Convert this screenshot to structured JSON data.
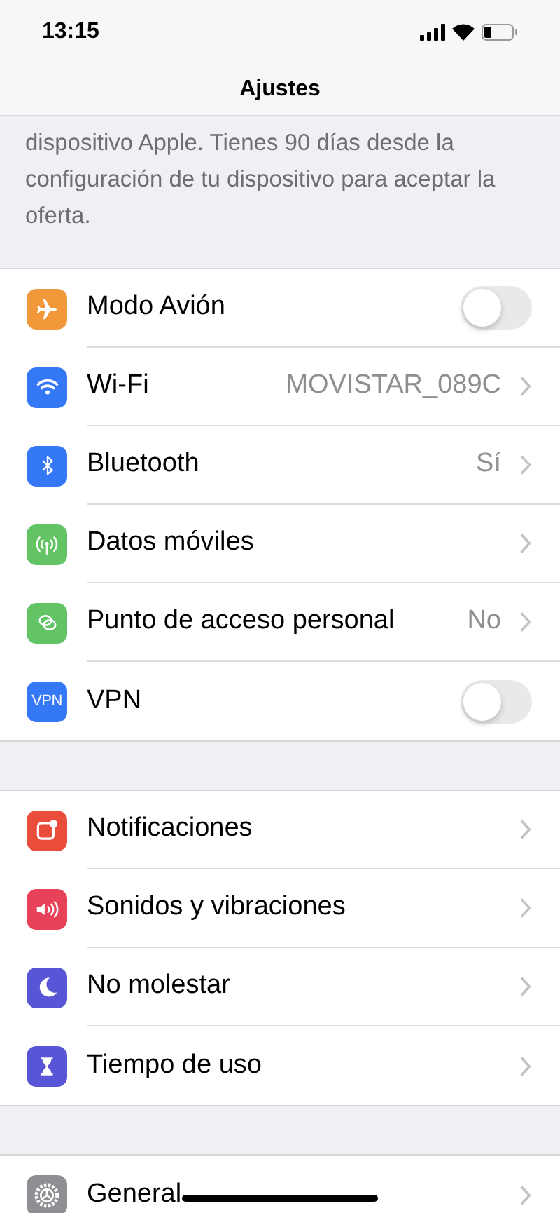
{
  "status_bar": {
    "time": "13:15"
  },
  "nav_bar": {
    "title": "Ajustes"
  },
  "notice": "dispositivo Apple. Tienes 90 días desde la configuración de tu dispositivo para aceptar la oferta.",
  "groups": [
    {
      "rows": [
        {
          "kind": "toggle",
          "label": "Modo Avión",
          "on": false,
          "color": "#f0983a"
        },
        {
          "kind": "value",
          "label": "Wi-Fi",
          "value": "MOVISTAR_089C",
          "color": "#3478f6"
        },
        {
          "kind": "value",
          "label": "Bluetooth",
          "value": "Sí",
          "color": "#3478f6"
        },
        {
          "kind": "chevron",
          "label": "Datos móviles",
          "color": "#63c466"
        },
        {
          "kind": "value",
          "label": "Punto de acceso personal",
          "value": "No",
          "color": "#63c466"
        },
        {
          "kind": "toggle",
          "label": "VPN",
          "on": false,
          "color": "#3478f6",
          "icon_text": "VPN"
        }
      ]
    },
    {
      "rows": [
        {
          "kind": "chevron",
          "label": "Notificaciones",
          "color": "#eb4d3d"
        },
        {
          "kind": "chevron",
          "label": "Sonidos y vibraciones",
          "color": "#e8425a"
        },
        {
          "kind": "chevron",
          "label": "No molestar",
          "color": "#5856d6"
        },
        {
          "kind": "chevron",
          "label": "Tiempo de uso",
          "color": "#5856d6"
        }
      ]
    },
    {
      "rows": [
        {
          "kind": "chevron",
          "label": "General",
          "color": "#8e8e93"
        }
      ]
    }
  ]
}
